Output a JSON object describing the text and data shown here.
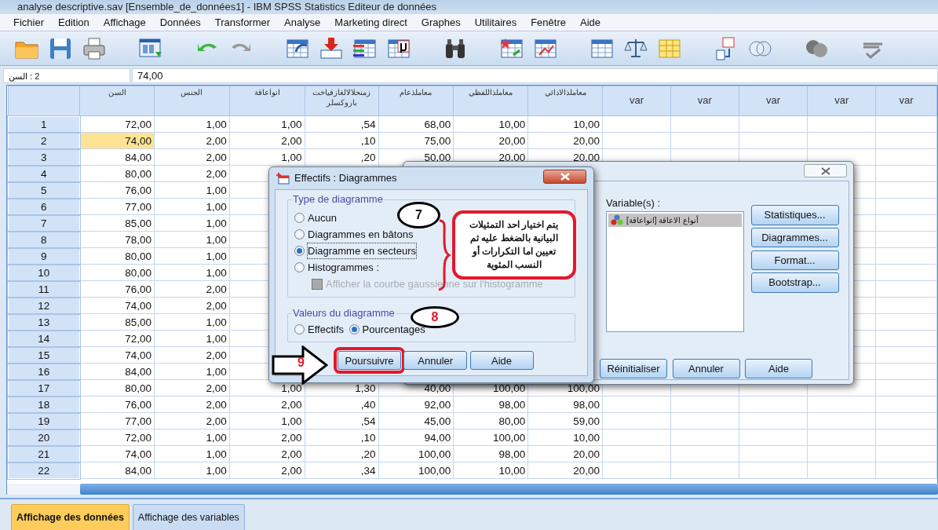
{
  "window": {
    "title": "analyse descriptive.sav [Ensemble_de_données1] - IBM SPSS Statistics Editeur de données"
  },
  "menu": [
    "Fichier",
    "Edition",
    "Affichage",
    "Données",
    "Transformer",
    "Analyse",
    "Marketing direct",
    "Graphes",
    "Utilitaires",
    "Fenêtre",
    "Aide"
  ],
  "cell_editor": {
    "reference": "2 : السن",
    "value": "74,00"
  },
  "grid": {
    "columns": [
      "السن",
      "الجنس",
      "انواعاقة",
      "زمنحلالالغازفياخت باروكسلر",
      "معاملذعام",
      "معاملذاللفظي",
      "معاملذالادائي",
      "var",
      "var",
      "var",
      "var",
      "var"
    ],
    "rows": [
      {
        "number": "1",
        "cells": [
          {
            "value": "72,00",
            "selected": false
          },
          {
            "value": "1,00",
            "selected": false
          },
          {
            "value": "1,00",
            "selected": false
          },
          {
            "value": ",54",
            "selected": false
          },
          {
            "value": "68,00",
            "selected": false
          },
          {
            "value": "10,00",
            "selected": false
          },
          {
            "value": "10,00",
            "selected": false
          }
        ]
      },
      {
        "number": "2",
        "cells": [
          {
            "value": "74,00",
            "selected": true
          },
          {
            "value": "2,00",
            "selected": false
          },
          {
            "value": "2,00",
            "selected": false
          },
          {
            "value": ",10",
            "selected": false
          },
          {
            "value": "75,00",
            "selected": false
          },
          {
            "value": "20,00",
            "selected": false
          },
          {
            "value": "20,00",
            "selected": false
          }
        ]
      },
      {
        "number": "3",
        "cells": [
          {
            "value": "84,00",
            "selected": false
          },
          {
            "value": "2,00",
            "selected": false
          },
          {
            "value": "1,00",
            "selected": false
          },
          {
            "value": ",20",
            "selected": false
          },
          {
            "value": "50,00",
            "selected": false
          },
          {
            "value": "20,00",
            "selected": false
          },
          {
            "value": "20,00",
            "selected": false
          }
        ]
      },
      {
        "number": "4",
        "cells": [
          {
            "value": "80,00",
            "selected": false
          },
          {
            "value": "2,00",
            "selected": false
          },
          null,
          null,
          null,
          null,
          null
        ]
      },
      {
        "number": "5",
        "cells": [
          {
            "value": "76,00",
            "selected": false
          },
          {
            "value": "1,00",
            "selected": false
          },
          null,
          null,
          null,
          null,
          null
        ]
      },
      {
        "number": "6",
        "cells": [
          {
            "value": "77,00",
            "selected": false
          },
          {
            "value": "1,00",
            "selected": false
          },
          null,
          null,
          null,
          null,
          null
        ]
      },
      {
        "number": "7",
        "cells": [
          {
            "value": "85,00",
            "selected": false
          },
          {
            "value": "1,00",
            "selected": false
          },
          null,
          null,
          null,
          null,
          null
        ]
      },
      {
        "number": "8",
        "cells": [
          {
            "value": "78,00",
            "selected": false
          },
          {
            "value": "1,00",
            "selected": false
          },
          null,
          null,
          null,
          null,
          null
        ]
      },
      {
        "number": "9",
        "cells": [
          {
            "value": "80,00",
            "selected": false
          },
          {
            "value": "1,00",
            "selected": false
          },
          null,
          null,
          null,
          null,
          null
        ]
      },
      {
        "number": "10",
        "cells": [
          {
            "value": "80,00",
            "selected": false
          },
          {
            "value": "1,00",
            "selected": false
          },
          null,
          null,
          null,
          null,
          null
        ]
      },
      {
        "number": "11",
        "cells": [
          {
            "value": "76,00",
            "selected": false
          },
          {
            "value": "2,00",
            "selected": false
          },
          null,
          null,
          null,
          null,
          null
        ]
      },
      {
        "number": "12",
        "cells": [
          {
            "value": "74,00",
            "selected": false
          },
          {
            "value": "2,00",
            "selected": false
          },
          null,
          null,
          null,
          null,
          null
        ]
      },
      {
        "number": "13",
        "cells": [
          {
            "value": "85,00",
            "selected": false
          },
          {
            "value": "1,00",
            "selected": false
          },
          null,
          null,
          null,
          null,
          null
        ]
      },
      {
        "number": "14",
        "cells": [
          {
            "value": "72,00",
            "selected": false
          },
          {
            "value": "1,00",
            "selected": false
          },
          null,
          null,
          null,
          null,
          null
        ]
      },
      {
        "number": "15",
        "cells": [
          {
            "value": "74,00",
            "selected": false
          },
          {
            "value": "2,00",
            "selected": false
          },
          null,
          null,
          null,
          null,
          null
        ]
      },
      {
        "number": "16",
        "cells": [
          {
            "value": "84,00",
            "selected": false
          },
          {
            "value": "1,00",
            "selected": false
          },
          null,
          null,
          null,
          null,
          null
        ]
      },
      {
        "number": "17",
        "cells": [
          {
            "value": "80,00",
            "selected": false
          },
          {
            "value": "2,00",
            "selected": false
          },
          {
            "value": "1,00",
            "selected": false
          },
          {
            "value": "1,30",
            "selected": false
          },
          {
            "value": "40,00",
            "selected": false
          },
          {
            "value": "100,00",
            "selected": false
          },
          {
            "value": "100,00",
            "selected": false
          }
        ]
      },
      {
        "number": "18",
        "cells": [
          {
            "value": "76,00",
            "selected": false
          },
          {
            "value": "2,00",
            "selected": false
          },
          {
            "value": "2,00",
            "selected": false
          },
          {
            "value": ",40",
            "selected": false
          },
          {
            "value": "92,00",
            "selected": false
          },
          {
            "value": "98,00",
            "selected": false
          },
          {
            "value": "98,00",
            "selected": false
          }
        ]
      },
      {
        "number": "19",
        "cells": [
          {
            "value": "77,00",
            "selected": false
          },
          {
            "value": "2,00",
            "selected": false
          },
          {
            "value": "1,00",
            "selected": false
          },
          {
            "value": ",54",
            "selected": false
          },
          {
            "value": "45,00",
            "selected": false
          },
          {
            "value": "80,00",
            "selected": false
          },
          {
            "value": "59,00",
            "selected": false
          }
        ]
      },
      {
        "number": "20",
        "cells": [
          {
            "value": "72,00",
            "selected": false
          },
          {
            "value": "1,00",
            "selected": false
          },
          {
            "value": "2,00",
            "selected": false
          },
          {
            "value": ",10",
            "selected": false
          },
          {
            "value": "94,00",
            "selected": false
          },
          {
            "value": "100,00",
            "selected": false
          },
          {
            "value": "10,00",
            "selected": false
          }
        ]
      },
      {
        "number": "21",
        "cells": [
          {
            "value": "74,00",
            "selected": false
          },
          {
            "value": "1,00",
            "selected": false
          },
          {
            "value": "2,00",
            "selected": false
          },
          {
            "value": ",20",
            "selected": false
          },
          {
            "value": "100,00",
            "selected": false
          },
          {
            "value": "98,00",
            "selected": false
          },
          {
            "value": "20,00",
            "selected": false
          }
        ]
      },
      {
        "number": "22",
        "cells": [
          {
            "value": "84,00",
            "selected": false
          },
          {
            "value": "1,00",
            "selected": false
          },
          {
            "value": "2,00",
            "selected": false
          },
          {
            "value": ",34",
            "selected": false
          },
          {
            "value": "100,00",
            "selected": false
          },
          {
            "value": "10,00",
            "selected": false
          },
          {
            "value": "20,00",
            "selected": false
          }
        ]
      }
    ]
  },
  "tabs": [
    {
      "label": "Affichage des données",
      "selected": true
    },
    {
      "label": "Affichage des variables",
      "selected": false
    }
  ],
  "frequencies_dialog": {
    "variables_label": "Variable(s) :",
    "variables": [
      {
        "label": "أنواع الاعاقة [انواعاقة]",
        "selected": true
      }
    ],
    "side_buttons": [
      "Statistiques...",
      "Diagrammes...",
      "Format...",
      "Bootstrap..."
    ],
    "bottom_buttons": [
      "Réinitialiser",
      "Annuler",
      "Aide"
    ]
  },
  "charts_dialog": {
    "title": "Effectifs : Diagrammes",
    "type_group": {
      "label": "Type de diagramme",
      "options": [
        {
          "label": "Aucun",
          "selected": false,
          "focused": false
        },
        {
          "label": "Diagrammes en bâtons",
          "selected": false,
          "focused": false
        },
        {
          "label": "Diagramme en secteurs",
          "selected": true,
          "focused": true
        },
        {
          "label": "Histogrammes :",
          "selected": false,
          "focused": false
        }
      ],
      "gaussian": {
        "label": "Afficher la courbe gaussienne sur l'histogramme",
        "checked": false,
        "disabled": true
      }
    },
    "values_group": {
      "label": "Valeurs du diagramme",
      "options": [
        {
          "label": "Effectifs",
          "selected": false
        },
        {
          "label": "Pourcentages",
          "selected": true
        }
      ]
    },
    "buttons": [
      {
        "label": "Poursuivre",
        "annotated": true
      },
      {
        "label": "Annuler",
        "annotated": false
      },
      {
        "label": "Aide",
        "annotated": false
      }
    ]
  },
  "annotations": [
    {
      "kind": "bubble",
      "text": "7"
    },
    {
      "kind": "note",
      "text": "يتم اختيار احد التمثيلات البيانية بالضغط عليه ثم تعيين اما التكرارات أو النسب المئوية"
    },
    {
      "kind": "bubble",
      "text": "8"
    },
    {
      "kind": "arrow",
      "text": "9"
    }
  ]
}
